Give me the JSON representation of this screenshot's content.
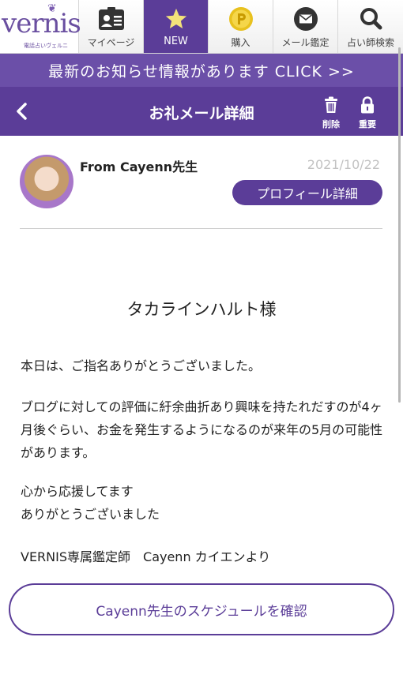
{
  "colors": {
    "brand": "#5b3d98",
    "notice_bg": "#6b4fa8",
    "coin": "#e8c11e",
    "date": "#c2c2c2"
  },
  "logo": {
    "text": "vernis",
    "sub": "電話占いヴェルニ"
  },
  "nav": [
    {
      "label": "マイページ",
      "icon": "id-card-icon",
      "active": false
    },
    {
      "label": "NEW",
      "icon": "star-icon",
      "active": true
    },
    {
      "label": "購入",
      "icon": "coin-icon",
      "active": false
    },
    {
      "label": "メール鑑定",
      "icon": "mail-icon",
      "active": false
    },
    {
      "label": "占い師検索",
      "icon": "search-icon",
      "active": false
    }
  ],
  "notice": {
    "text": "最新のお知らせ情報があります CLICK >>"
  },
  "titlebar": {
    "title": "お礼メール詳細",
    "delete_label": "削除",
    "important_label": "重要"
  },
  "message": {
    "from": "From Cayenn先生",
    "date": "2021/10/22",
    "profile_button": "プロフィール詳細",
    "greeting": "タカラインハルト様",
    "paragraphs": [
      "本日は、ご指名ありがとうございました。",
      "ブログに対しての評価に紆余曲折あり興味を持たれだすのが4ヶ月後ぐらい、お金を発生するようになるのが来年の5月の可能性があります。",
      "心から応援してます\nありがとうございました",
      "VERNIS専属鑑定師　Cayenn カイエンより"
    ]
  },
  "schedule_button": "Cayenn先生のスケジュールを確認"
}
